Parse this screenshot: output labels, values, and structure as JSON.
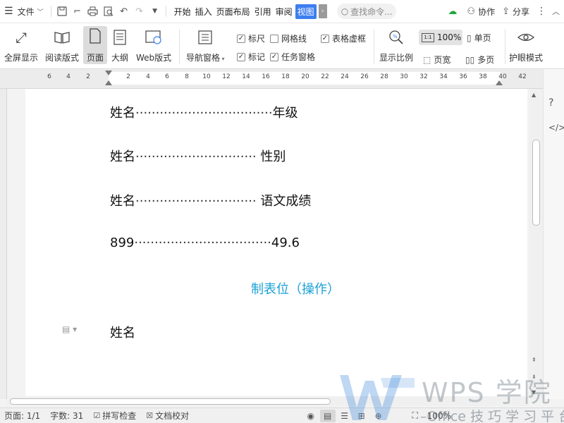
{
  "topbar": {
    "menu_label": "文件",
    "tabs": [
      {
        "label": "开始",
        "active": false
      },
      {
        "label": "插入",
        "active": false
      },
      {
        "label": "页面布局",
        "active": false
      },
      {
        "label": "引用",
        "active": false
      },
      {
        "label": "审阅",
        "active": false
      },
      {
        "label": "视图",
        "active": true
      }
    ],
    "search_placeholder": "查找命令...",
    "collab_label": "协作",
    "share_label": "分享"
  },
  "ribbon": {
    "fullscreen": "全屏显示",
    "reading": "阅读版式",
    "page": "页面",
    "outline": "大纲",
    "web": "Web版式",
    "nav_pane": "导航窗格",
    "ruler_check": "标尺",
    "grid_check": "网格线",
    "table_dash_check": "表格虚框",
    "mark_check": "标记",
    "task_pane_check": "任务窗格",
    "zoom_ratio": "显示比例",
    "zoom_value": "100%",
    "single_page": "单页",
    "page_width": "页宽",
    "multi_page": "多页",
    "eye_mode": "护眼模式",
    "checks": {
      "ruler": true,
      "grid": false,
      "table_dash": true,
      "mark": true,
      "task_pane": true
    }
  },
  "ruler": {
    "numbers": [
      "6",
      "4",
      "2",
      "2",
      "4",
      "6",
      "8",
      "10",
      "12",
      "14",
      "16",
      "18",
      "20",
      "22",
      "24",
      "26",
      "28",
      "30",
      "32",
      "34",
      "36",
      "38",
      "40",
      "42"
    ]
  },
  "document": {
    "lines": [
      {
        "left": "姓名",
        "dots": "··································",
        "right": "年级"
      },
      {
        "left": "姓名",
        "dots": "······························",
        "right": " 性别"
      },
      {
        "left": "姓名",
        "dots": "······························",
        "right": " 语文成绩"
      },
      {
        "left": "899",
        "dots": "··································",
        "right": "49.6"
      },
      {
        "left": "姓名",
        "dots": "",
        "right": ""
      }
    ],
    "annotation": "制表位（操作）"
  },
  "status": {
    "page": "页面: 1/1",
    "words": "字数: 31",
    "spell": "拼写检查",
    "proof": "文档校对",
    "zoom": "100%"
  },
  "watermark": {
    "title": "WPS 学院",
    "subtitle": "–Office 技 巧 学 习 平 台"
  },
  "colors": {
    "accent": "#3d7ef0",
    "annotation": "#1aa0d6",
    "cloud": "#1ea63a"
  }
}
